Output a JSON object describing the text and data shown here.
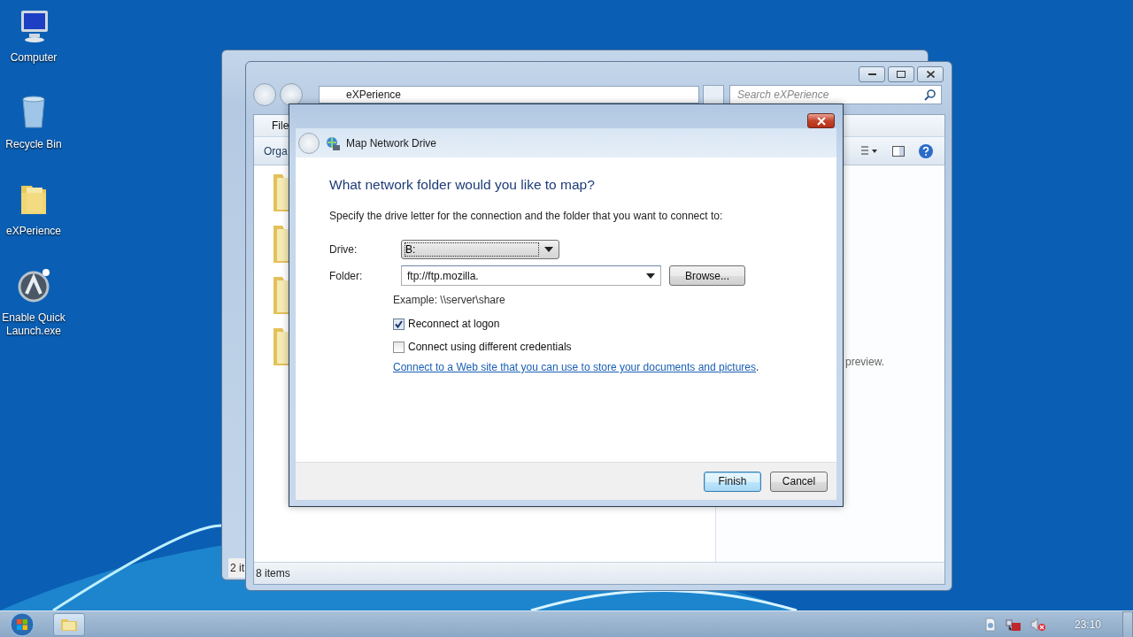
{
  "desktop": {
    "icons": [
      {
        "label": "Computer",
        "kind": "computer"
      },
      {
        "label": "Recycle Bin",
        "kind": "bin"
      },
      {
        "label": "eXPerience",
        "kind": "folder"
      },
      {
        "label": "Enable Quick Launch.exe",
        "kind": "app"
      }
    ]
  },
  "background_window": {
    "status_text": "2 it"
  },
  "explorer": {
    "address": "eXPerience",
    "search": {
      "placeholder": "Search eXPerience"
    },
    "menu": [
      "File"
    ],
    "command": "Orga",
    "preview_text": "preview.",
    "status_bar": "8 items"
  },
  "dialog": {
    "title": "Map Network Drive",
    "heading": "What network folder would you like to map?",
    "instruction": "Specify the drive letter for the connection and the folder that you want to connect to:",
    "drive": {
      "label": "Drive:",
      "value": "B:"
    },
    "folder": {
      "label": "Folder:",
      "value": "ftp://ftp.mozilla."
    },
    "browse_button": "Browse...",
    "example": "Example: \\\\server\\share",
    "options": [
      {
        "label": "Reconnect at logon",
        "checked": true
      },
      {
        "label": "Connect using different credentials",
        "checked": false
      }
    ],
    "link": "Connect to a Web site that you can use to store your documents and pictures",
    "link_suffix": ".",
    "buttons": [
      {
        "label": "Finish",
        "default": true
      },
      {
        "label": "Cancel",
        "default": false
      }
    ]
  },
  "taskbar": {
    "clock": "23:10"
  }
}
